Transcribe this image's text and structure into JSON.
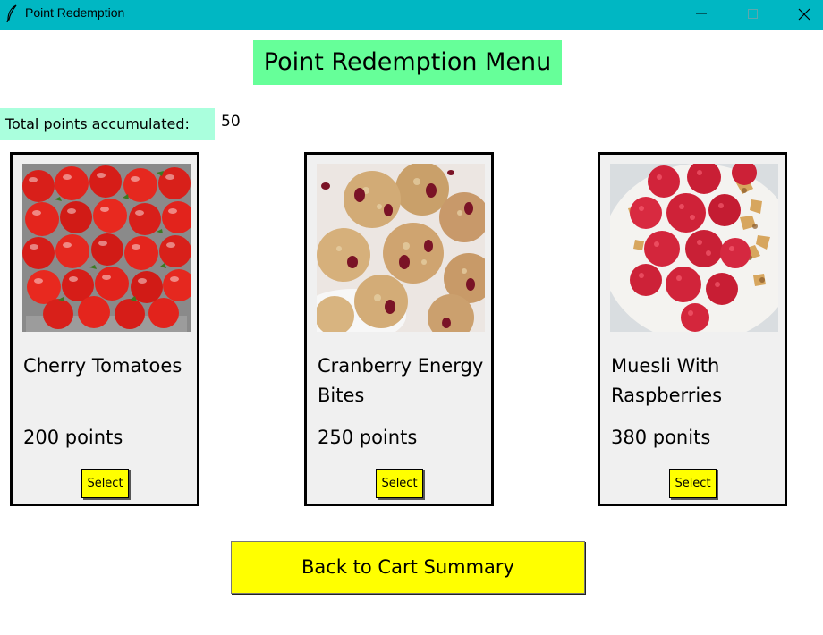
{
  "window": {
    "title": "Point Redemption",
    "icon": "feather-icon",
    "titlebar_color": "#00b7c3"
  },
  "heading": "Point Redemption Menu",
  "points": {
    "label": "Total points accumulated:",
    "value": "50"
  },
  "items": [
    {
      "name": "Cherry Tomatoes",
      "points": "200 points",
      "button": "Select",
      "image": "cherry-tomatoes-image"
    },
    {
      "name": "Cranberry Energy Bites",
      "points": "250 points",
      "button": "Select",
      "image": "cranberry-energy-bites-image"
    },
    {
      "name": "Muesli With Raspberries",
      "points": "380 ponits",
      "button": "Select",
      "image": "muesli-raspberries-image"
    }
  ],
  "back_button": "Back to Cart Summary",
  "colors": {
    "heading_bg": "#66ff99",
    "points_label_bg": "#aaffdd",
    "button_bg": "#ffff00",
    "card_bg": "#f0f0f0"
  }
}
